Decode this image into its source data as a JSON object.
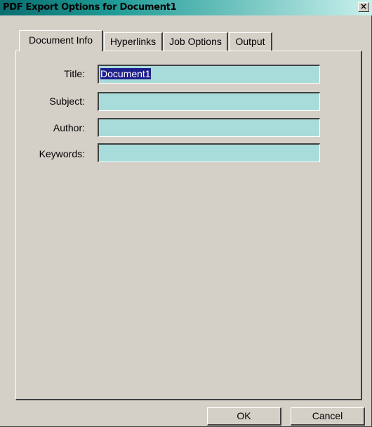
{
  "window": {
    "title": "PDF Export Options for Document1",
    "close_label": "×"
  },
  "tabs": [
    {
      "label": "Document Info",
      "active": true
    },
    {
      "label": "Hyperlinks",
      "active": false
    },
    {
      "label": "Job Options",
      "active": false
    },
    {
      "label": "Output",
      "active": false
    }
  ],
  "fields": {
    "title": {
      "label": "Title:",
      "value": "Document1"
    },
    "subject": {
      "label": "Subject:",
      "value": ""
    },
    "author": {
      "label": "Author:",
      "value": ""
    },
    "keywords": {
      "label": "Keywords:",
      "value": ""
    }
  },
  "buttons": {
    "ok": "OK",
    "cancel": "Cancel"
  },
  "colors": {
    "titlebar_start": "#0a6e70",
    "field_background": "#a7dcda",
    "selection": "#1e1e8c",
    "dialog_face": "#d4d0c8"
  }
}
